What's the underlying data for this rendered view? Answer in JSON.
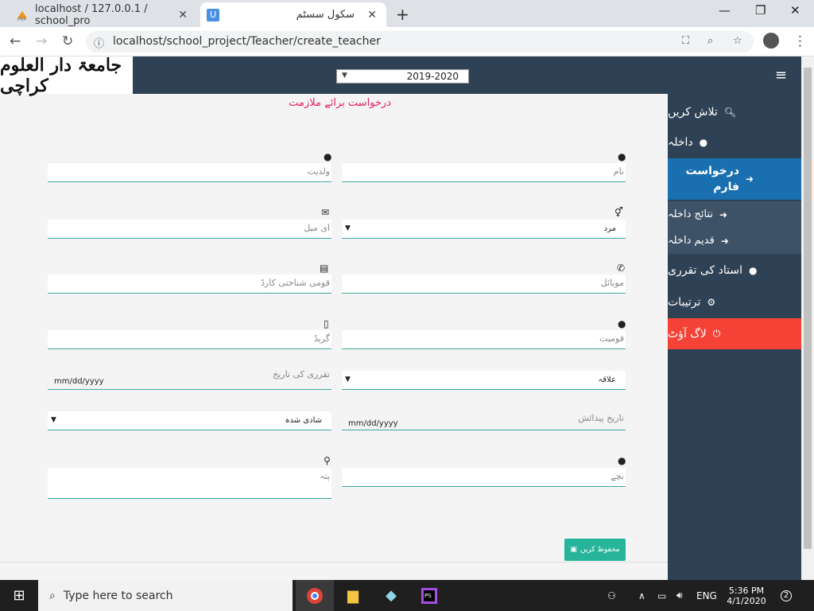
{
  "browser": {
    "tabs": [
      {
        "label": "localhost / 127.0.0.1 / school_pro",
        "favicon": "phpmyadmin-icon"
      },
      {
        "label": "سکول سسٹم",
        "favicon": "U"
      }
    ],
    "url": "localhost/school_project/Teacher/create_teacher"
  },
  "header": {
    "logo_text": "جامعۃ دار العلوم کراچی",
    "year": "2019-2020"
  },
  "sidebar": {
    "items": [
      {
        "label": "تلاش کریں",
        "icon": "search-icon"
      },
      {
        "label": "داخلہ",
        "icon": "user-icon"
      },
      {
        "label": "درخواست فارم",
        "icon": "arrow-circle-icon"
      },
      {
        "label": "نتائج داخلہ",
        "icon": "arrow-circle-icon"
      },
      {
        "label": "قدیم داخلہ",
        "icon": "arrow-circle-icon"
      },
      {
        "label": "استاد کی تقرری",
        "icon": "user-icon"
      },
      {
        "label": "ترتیبات",
        "icon": "gear-icon"
      },
      {
        "label": "لاگ آؤٹ",
        "icon": "power-icon"
      }
    ]
  },
  "form": {
    "title": "درخواست برائے ملازمت",
    "name_ph": "نام",
    "father_ph": "ولدیت",
    "gender_val": "مرد",
    "email_ph": "ای میل",
    "mobile_ph": "موبائل",
    "cnic_ph": "قومی شناختی کارڈ",
    "nationality_ph": "قومیت",
    "grade_ph": "گریڈ",
    "region_val": "علاقہ",
    "appoint_date_ph": "تقرری کی تاریخ",
    "appoint_date_val": "mm/dd/yyyy",
    "dob_ph": "تاریخ پیدائش",
    "dob_val": "mm/dd/yyyy",
    "marital_val": "شادی شدہ",
    "children_ph": "بچے",
    "address_ph": "پتہ",
    "save_label": "محفوظ کریں"
  },
  "taskbar": {
    "search_placeholder": "Type here to search",
    "lang": "ENG",
    "time": "5:36 PM",
    "date": "4/1/2020",
    "notif_count": "2"
  }
}
